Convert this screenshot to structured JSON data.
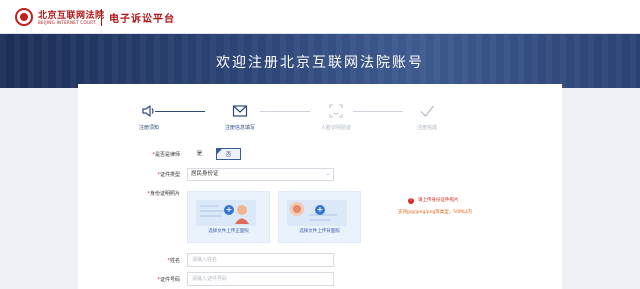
{
  "header": {
    "court_name": "北京互联网法院",
    "court_en": "BEIJING INTERNET COURT",
    "platform": "电子诉讼平台"
  },
  "banner": {
    "title": "欢迎注册北京互联网法院账号"
  },
  "steps": [
    {
      "label": "注册须知",
      "status": "done",
      "icon": "speaker-icon"
    },
    {
      "label": "注册信息填写",
      "status": "current",
      "icon": "envelope-icon"
    },
    {
      "label": "人脸识别验证",
      "status": "todo",
      "icon": "face-scan-icon"
    },
    {
      "label": "注册完成",
      "status": "todo",
      "icon": "checkmark-icon"
    }
  ],
  "form": {
    "lawyer": {
      "label": "是否是律师",
      "yes": "是",
      "no": "否",
      "selected": "否"
    },
    "id_type": {
      "label": "证件类型",
      "value": "居民身份证"
    },
    "id_photo": {
      "label": "身份证明照片",
      "front_caption": "选择文件上传正面照",
      "back_caption": "选择文件上传背面照",
      "error": "请上传身份证件照片",
      "hint": "支持jpg/jpeg/png等类型，50M以内"
    },
    "name": {
      "label": "姓名",
      "placeholder": "请输入姓名"
    },
    "id_number": {
      "label": "证件号码",
      "placeholder": "请输入证件号码"
    }
  },
  "colors": {
    "brand_red": "#b31414",
    "accent_blue": "#2f4a80",
    "upload_blue": "#3574d4",
    "error_red": "#d8251e",
    "hint_orange": "#e0661c"
  }
}
